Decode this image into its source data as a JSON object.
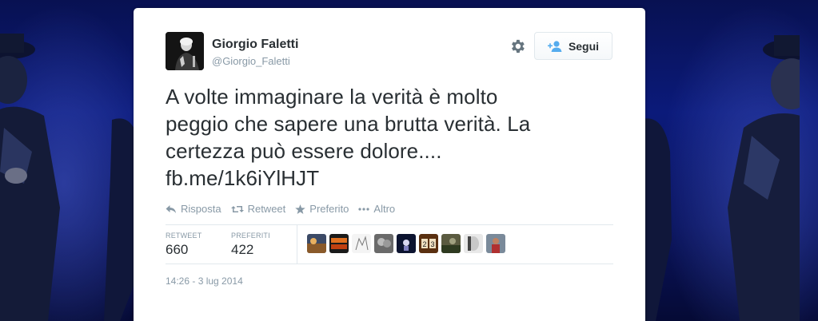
{
  "tweet": {
    "author": {
      "display_name": "Giorgio Faletti",
      "screen_name": "@Giorgio_Faletti"
    },
    "follow_label": "Segui",
    "text_lines": [
      "A volte immaginare la verità è molto",
      "peggio che sapere una brutta verità. La",
      "certezza può essere dolore...."
    ],
    "link": "fb.me/1k6iYlHJT",
    "actions": [
      {
        "label": "Risposta",
        "icon": "reply-icon"
      },
      {
        "label": "Retweet",
        "icon": "retweet-icon"
      },
      {
        "label": "Preferito",
        "icon": "star-icon"
      },
      {
        "label": "Altro",
        "icon": "more-icon"
      }
    ],
    "stats": {
      "retweets_label": "RETWEET",
      "retweets_value": "660",
      "favorites_label": "PREFERITI",
      "favorites_value": "422"
    },
    "timestamp": "14:26 - 3 lug 2014"
  },
  "colors": {
    "text": "#292f33",
    "muted": "#8899a6",
    "border": "#e1e8ed",
    "accent": "#55acee",
    "background": "#0b1a7a"
  }
}
